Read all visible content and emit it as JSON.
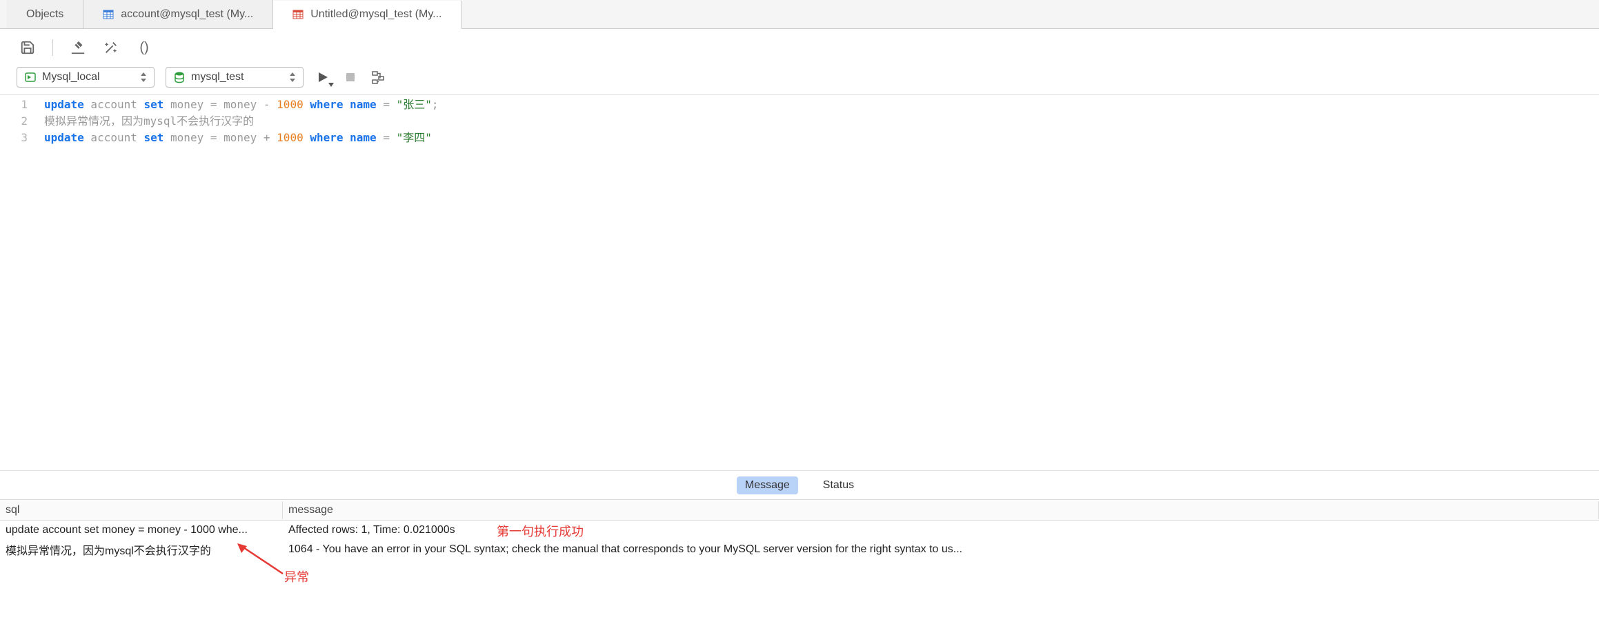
{
  "tabs": [
    {
      "label": "Objects",
      "icon": null,
      "active": false
    },
    {
      "label": "account@mysql_test (My...",
      "icon": "table-blue",
      "active": false
    },
    {
      "label": "Untitled@mysql_test (My...",
      "icon": "table-red",
      "active": true
    }
  ],
  "toolbar1": {
    "save": "save",
    "hammer": "format",
    "wand": "beautify",
    "paren": "()"
  },
  "connections": {
    "server": "Mysql_local",
    "database": "mysql_test"
  },
  "code": {
    "lines": [
      {
        "n": "1",
        "tokens": [
          {
            "t": "kw",
            "v": "update"
          },
          {
            "t": "plain",
            "v": " account "
          },
          {
            "t": "kw",
            "v": "set"
          },
          {
            "t": "plain",
            "v": " money = money - "
          },
          {
            "t": "num",
            "v": "1000"
          },
          {
            "t": "plain",
            "v": " "
          },
          {
            "t": "kw",
            "v": "where"
          },
          {
            "t": "plain",
            "v": " "
          },
          {
            "t": "kw",
            "v": "name"
          },
          {
            "t": "plain",
            "v": " = "
          },
          {
            "t": "str",
            "v": "\"张三\""
          },
          {
            "t": "sym",
            "v": ";"
          }
        ]
      },
      {
        "n": "2",
        "tokens": [
          {
            "t": "plain",
            "v": "模拟异常情况，因为mysql不会执行汉字的"
          }
        ]
      },
      {
        "n": "3",
        "tokens": [
          {
            "t": "kw",
            "v": "update"
          },
          {
            "t": "plain",
            "v": " account "
          },
          {
            "t": "kw",
            "v": "set"
          },
          {
            "t": "plain",
            "v": " money = money + "
          },
          {
            "t": "num",
            "v": "1000"
          },
          {
            "t": "plain",
            "v": " "
          },
          {
            "t": "kw",
            "v": "where"
          },
          {
            "t": "plain",
            "v": " "
          },
          {
            "t": "kw",
            "v": "name"
          },
          {
            "t": "plain",
            "v": " = "
          },
          {
            "t": "str",
            "v": "\"李四\""
          }
        ]
      }
    ]
  },
  "resultTabs": {
    "message": "Message",
    "status": "Status"
  },
  "resultsHeader": {
    "sql": "sql",
    "message": "message"
  },
  "resultsRows": [
    {
      "sql": "update account set money = money - 1000 whe...",
      "message": "Affected rows: 1, Time: 0.021000s"
    },
    {
      "sql": "模拟异常情况，因为mysql不会执行汉字的",
      "message": "1064 - You have an error in your SQL syntax; check the manual that corresponds to your MySQL server version for the right syntax to us..."
    }
  ],
  "annotations": {
    "success": "第一句执行成功",
    "error": "异常"
  }
}
